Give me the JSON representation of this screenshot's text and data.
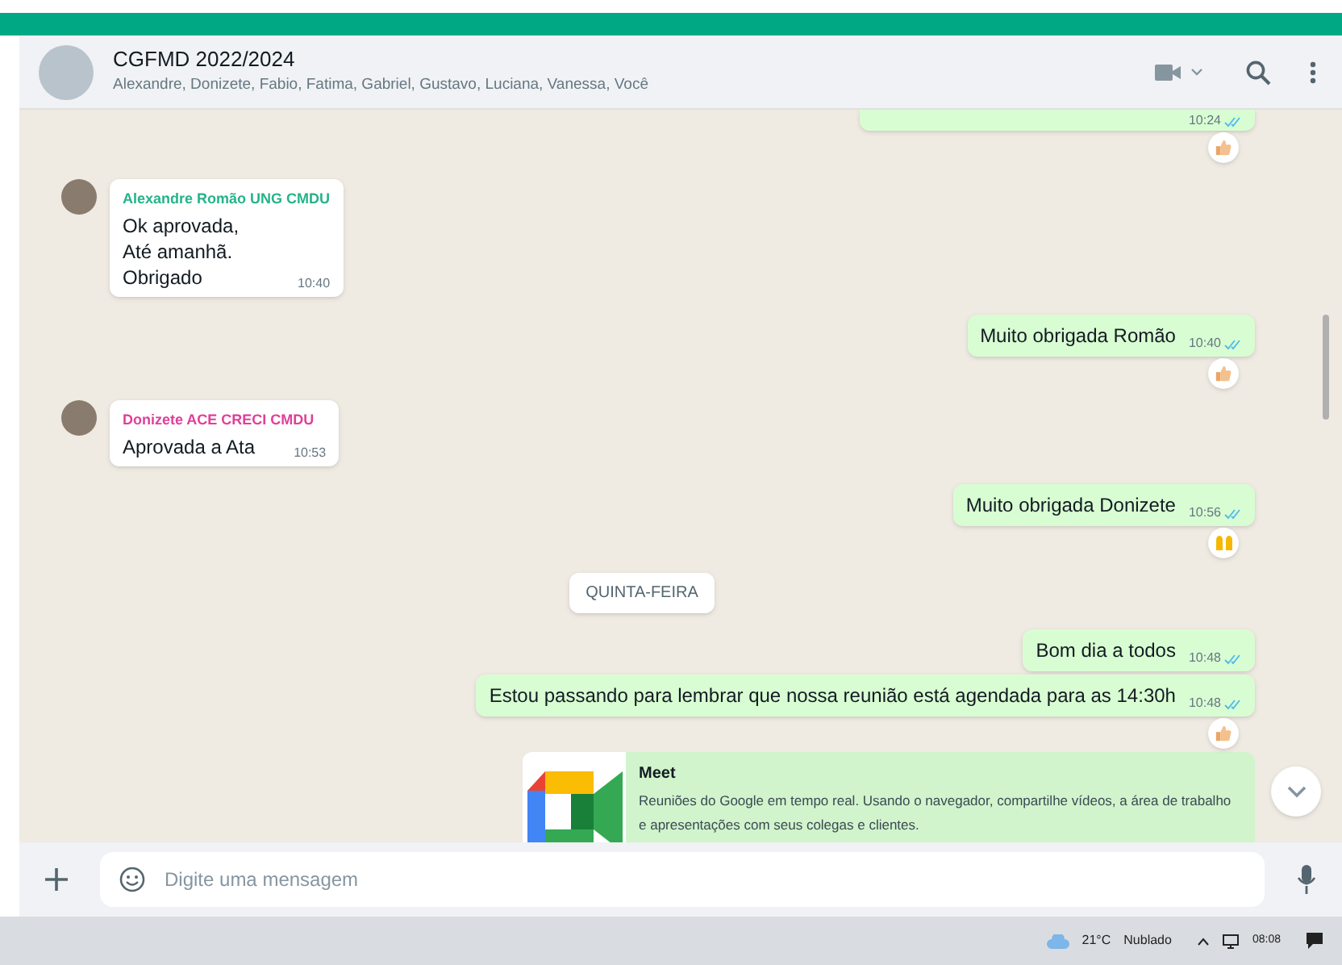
{
  "header": {
    "title": "CGFMD 2022/2024",
    "members": "Alexandre, Donizete, Fabio, Fatima, Gabriel, Gustavo, Luciana, Vanessa, Você"
  },
  "messages": [
    {
      "kind": "outgoing",
      "time": "10:24",
      "read": true,
      "reaction": {
        "kind": "thumbs-up"
      }
    },
    {
      "kind": "incoming",
      "sender": "Alexandre Romão UNG CMDU",
      "color": "#25b38a",
      "text": "Ok aprovada,\nAté amanhã.\nObrigado",
      "time": "10:40"
    },
    {
      "kind": "outgoing",
      "text": "Muito obrigada Romão",
      "time": "10:40",
      "read": true,
      "reaction": {
        "kind": "thumbs-up"
      }
    },
    {
      "kind": "incoming",
      "sender": "Donizete ACE CRECI CMDU",
      "color": "#e0409a",
      "text": "Aprovada a Ata",
      "time": "10:53"
    },
    {
      "kind": "outgoing",
      "text": "Muito obrigada Donizete",
      "time": "10:56",
      "read": true,
      "reaction": {
        "kind": "raised-hands"
      }
    },
    {
      "kind": "date",
      "text": "QUINTA-FEIRA"
    },
    {
      "kind": "outgoing",
      "text": "Bom dia a todos",
      "time": "10:48",
      "read": true
    },
    {
      "kind": "outgoing",
      "text": "Estou passando para lembrar que nossa reunião está agendada para as 14:30h",
      "time": "10:48",
      "read": true,
      "reaction": {
        "kind": "thumbs-up"
      }
    },
    {
      "kind": "link",
      "title": "Meet",
      "description": "Reuniões do Google em tempo real. Usando o navegador, compartilhe vídeos, a área de trabalho e apresentações com seus colegas e clientes."
    }
  ],
  "composer": {
    "placeholder": "Digite uma mensagem"
  },
  "taskbar": {
    "weather": "21°C",
    "condition": "Nublado",
    "clock": "08:08"
  }
}
